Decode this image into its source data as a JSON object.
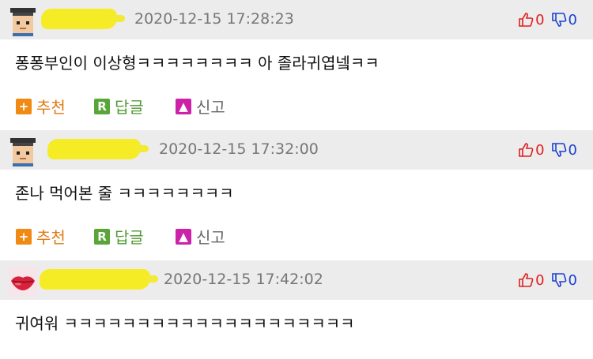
{
  "comments": [
    {
      "timestamp": "2020-12-15 17:28:23",
      "likes": "0",
      "dislikes": "0",
      "body": "퐁퐁부인이 이상형ㅋㅋㅋㅋㅋㅋㅋㅋ 아 졸라귀엽넼ㅋㅋ",
      "avatar": "grad-cap-avatar-icon",
      "actions": {
        "recommend": "추천",
        "reply": "답글",
        "report": "신고"
      }
    },
    {
      "timestamp": "2020-12-15 17:32:00",
      "likes": "0",
      "dislikes": "0",
      "body": "존나 먹어본 줄 ㅋㅋㅋㅋㅋㅋㅋㅋ",
      "avatar": "grad-cap-avatar-icon",
      "actions": {
        "recommend": "추천",
        "reply": "답글",
        "report": "신고"
      }
    },
    {
      "timestamp": "2020-12-15 17:42:02",
      "likes": "0",
      "dislikes": "0",
      "body": "귀여워 ㅋㅋㅋㅋㅋㅋㅋㅋㅋㅋㅋㅋㅋㅋㅋㅋㅋㅋㅋㅋ",
      "avatar": "lips-avatar-icon"
    }
  ],
  "colors": {
    "header_bg": "#ececec",
    "redaction": "#f7ec1b",
    "like": "#e01e1e",
    "dislike": "#1a3fcf",
    "recommend": "#f08a13",
    "reply": "#5aa53a",
    "report": "#cc22a8"
  }
}
